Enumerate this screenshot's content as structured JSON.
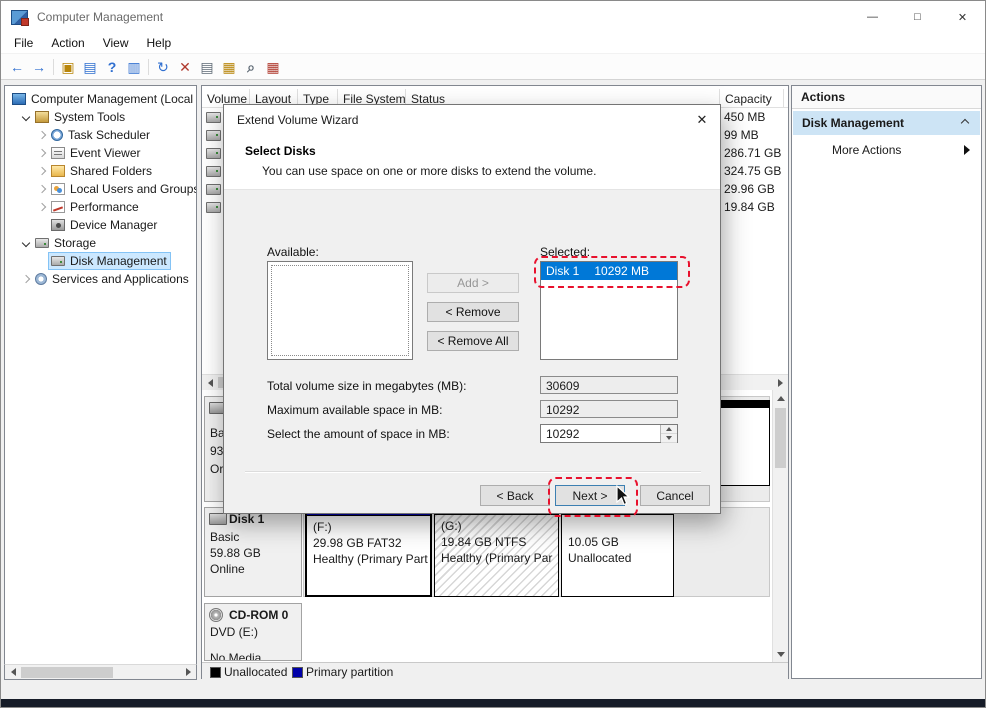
{
  "window": {
    "title": "Computer Management",
    "controls": {
      "minimize": "—",
      "maximize": "□",
      "close": "✕"
    }
  },
  "menubar": {
    "items": [
      "File",
      "Action",
      "View",
      "Help"
    ]
  },
  "toolbar": {
    "icons": [
      {
        "name": "back-icon",
        "glyph": "←"
      },
      {
        "name": "forward-icon",
        "glyph": "→"
      },
      {
        "name": "export-icon",
        "glyph": "▣"
      },
      {
        "name": "window-icon",
        "glyph": "▤"
      },
      {
        "name": "help-icon",
        "glyph": "?"
      },
      {
        "name": "console-tree-icon",
        "glyph": "▥"
      },
      {
        "name": "refresh-icon",
        "glyph": "↻"
      },
      {
        "name": "delete-icon",
        "glyph": "✕"
      },
      {
        "name": "properties-icon",
        "glyph": "▤"
      },
      {
        "name": "open-icon",
        "glyph": "▦"
      },
      {
        "name": "find-icon",
        "glyph": "⌕"
      },
      {
        "name": "snapin-icon",
        "glyph": "▦"
      }
    ]
  },
  "tree": {
    "items": [
      {
        "label": "Computer Management (Local"
      },
      {
        "label": "System Tools"
      },
      {
        "label": "Task Scheduler"
      },
      {
        "label": "Event Viewer"
      },
      {
        "label": "Shared Folders"
      },
      {
        "label": "Local Users and Groups"
      },
      {
        "label": "Performance"
      },
      {
        "label": "Device Manager"
      },
      {
        "label": "Storage"
      },
      {
        "label": "Disk Management"
      },
      {
        "label": "Services and Applications"
      }
    ]
  },
  "volume_list": {
    "columns": [
      "Volume",
      "Layout",
      "Type",
      "File System",
      "Status",
      "Capacity"
    ],
    "rows": [
      {
        "capacity": "450 MB"
      },
      {
        "capacity": "99 MB"
      },
      {
        "capacity": "286.71 GB"
      },
      {
        "capacity": "324.75 GB"
      },
      {
        "capacity": "29.96 GB"
      },
      {
        "capacity": "19.84 GB"
      }
    ]
  },
  "actions_panel": {
    "title": "Actions",
    "group": "Disk Management",
    "item": "More Actions"
  },
  "wizard": {
    "title": "Extend Volume Wizard",
    "close": "✕",
    "heading": "Select Disks",
    "subtitle": "You can use space on one or more disks to extend the volume.",
    "available_label": "Available:",
    "selected_label": "Selected:",
    "selected_item": {
      "name": "Disk 1",
      "size": "10292 MB"
    },
    "buttons": {
      "add": "Add >",
      "remove": "< Remove",
      "remove_all": "< Remove All",
      "back": "< Back",
      "next": "Next >",
      "cancel": "Cancel"
    },
    "fields": [
      {
        "label": "Total volume size in megabytes (MB):",
        "value": "30609"
      },
      {
        "label": "Maximum available space in MB:",
        "value": "10292"
      },
      {
        "label": "Select the amount of space in MB:",
        "value": "10292"
      }
    ]
  },
  "graphical_view": {
    "disk0": {
      "lines": [
        "Ba",
        "93",
        "Or"
      ]
    },
    "disk1": {
      "name": "Disk 1",
      "type": "Basic",
      "size": "59.88 GB",
      "status": "Online"
    },
    "partitions": {
      "f": {
        "name": "(F:)",
        "detail": "29.98 GB FAT32",
        "status": "Healthy (Primary Part"
      },
      "g": {
        "name": "(G:)",
        "detail": "19.84 GB NTFS",
        "status": "Healthy (Primary Par"
      },
      "unallocated": {
        "detail": "10.05 GB",
        "status": "Unallocated"
      }
    },
    "cdrom": {
      "name": "CD-ROM 0",
      "media": "DVD (E:)",
      "status": "No Media"
    }
  },
  "legend": {
    "items": [
      {
        "label": "Unallocated",
        "color": "#000000"
      },
      {
        "label": "Primary partition",
        "color": "#0000a8"
      }
    ]
  },
  "colors": {
    "list_selection": "#0078d7",
    "tree_selection": "#cce8ff",
    "actions_selection": "#cde4f5",
    "primary_partition": "#0000a8",
    "unallocated": "#000000",
    "annotation": "#e8112d"
  }
}
